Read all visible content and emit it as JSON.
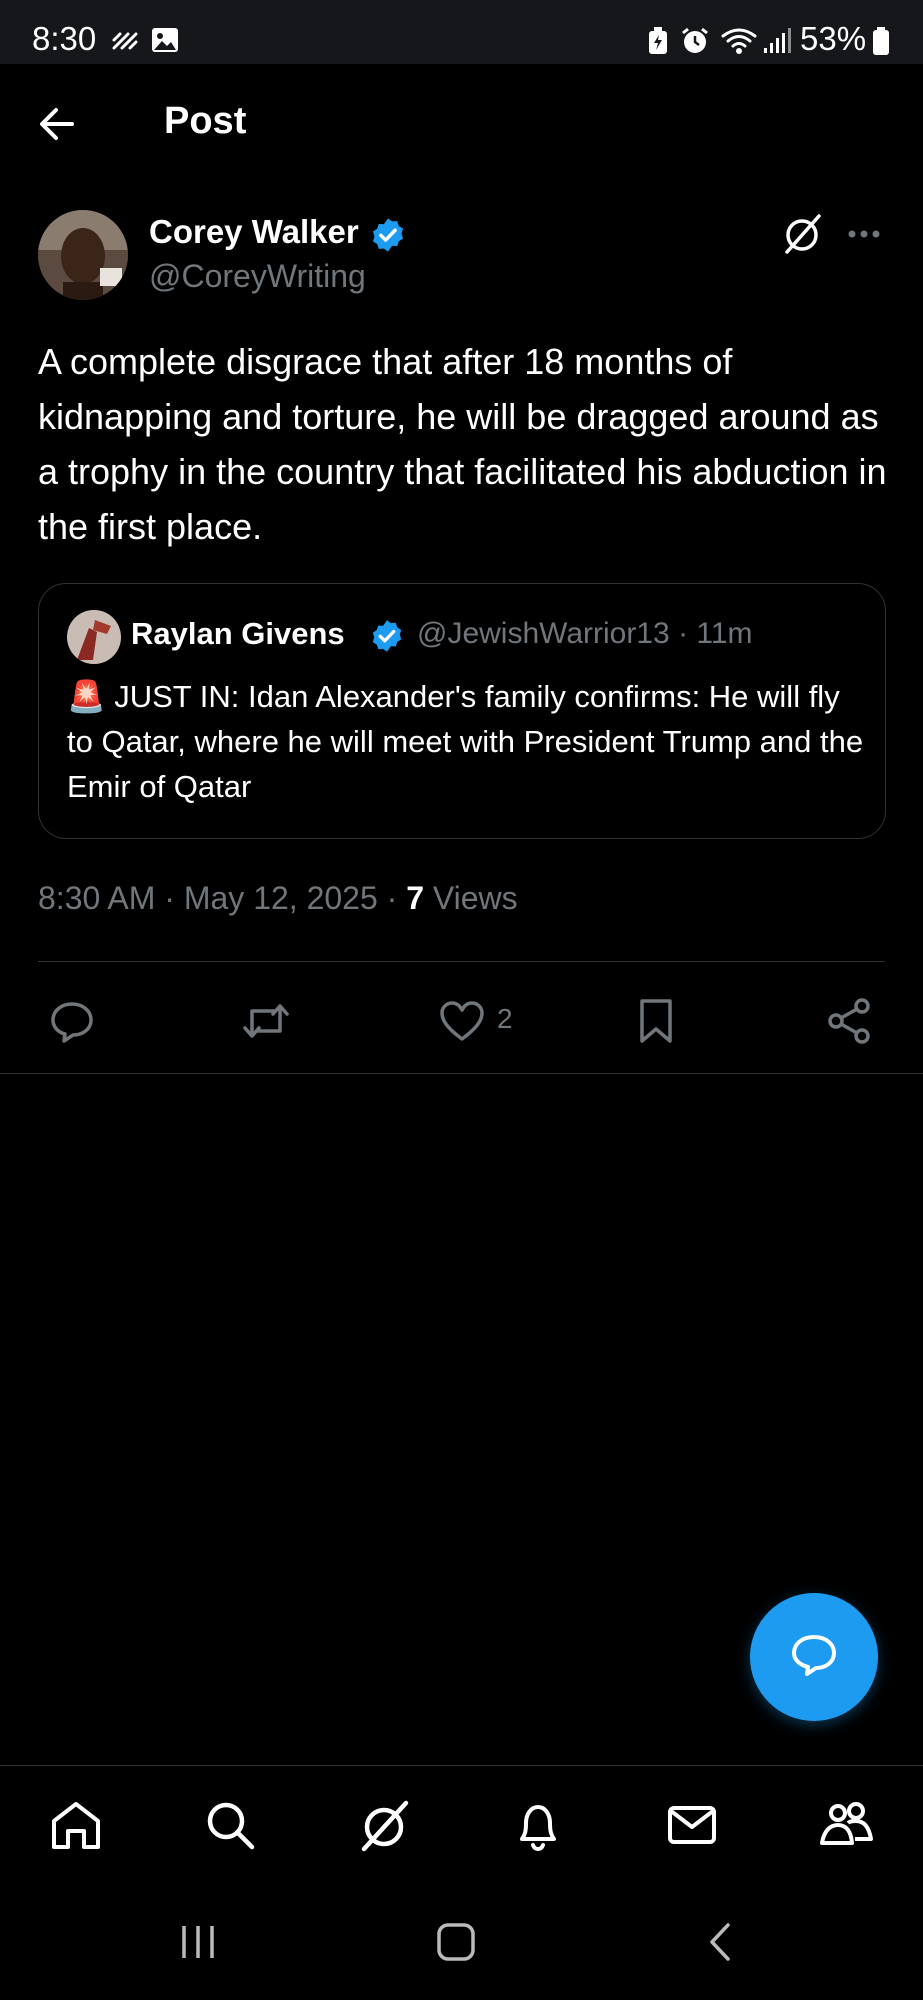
{
  "status_bar": {
    "time": "8:30",
    "battery": "53%",
    "icons": [
      "signal-dots-icon",
      "gallery-icon",
      "battery-saver-icon",
      "alarm-icon",
      "wifi-icon",
      "cell-signal-icon",
      "battery-icon"
    ]
  },
  "header": {
    "title": "Post"
  },
  "post": {
    "author_name": "Corey Walker",
    "author_handle": "@CoreyWriting",
    "text": "A complete disgrace that after 18 months of kidnapping and torture, he will be dragged around as a trophy in the country that facilitated his abduction in the first place.",
    "quote": {
      "name": "Raylan Givens",
      "handle": "@JewishWarrior13 · 11m",
      "emoji": "🚨",
      "text": "JUST IN: Idan Alexander's family confirms: He will fly to Qatar, where he will meet with President Trump and the Emir of Qatar"
    },
    "timestamp": "8:30 AM · May 12, 2025 · ",
    "views_count": "7",
    "views_label": " Views",
    "like_count": "2"
  },
  "colors": {
    "accent": "#1d9bf0",
    "background": "#000000",
    "muted": "#71767b"
  }
}
